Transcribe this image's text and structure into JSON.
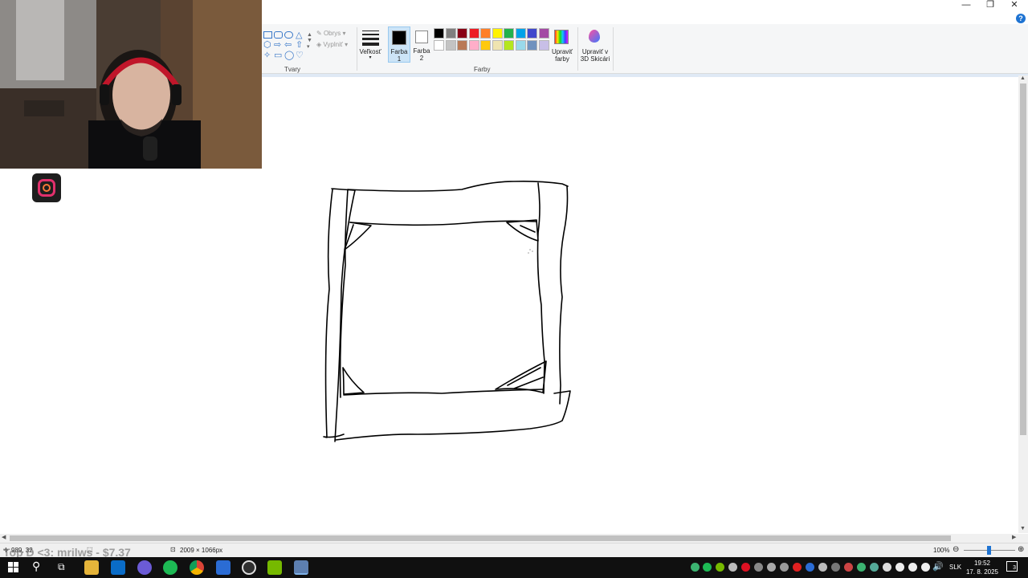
{
  "window": {
    "minimize_icon": "minimize-icon",
    "restore_icon": "restore-icon",
    "close_icon": "close-icon",
    "help_icon": "help-icon"
  },
  "ribbon": {
    "shapes_group_label": "Tvary",
    "outline_label": "Obrys",
    "fill_label": "Vyplniť",
    "size_label": "Veľkosť",
    "color1_label_a": "Farba",
    "color1_label_b": "1",
    "color2_label_a": "Farba",
    "color2_label_b": "2",
    "colors_group_label": "Farby",
    "edit_colors_a": "Upraviť",
    "edit_colors_b": "farby",
    "paint3d_a": "Upraviť v",
    "paint3d_b": "3D Skicári",
    "palette_row1": [
      "#000000",
      "#7f7f7f",
      "#880015",
      "#ed1c24",
      "#ff7f27",
      "#fff200",
      "#22b14c",
      "#00a2e8",
      "#3f48cc",
      "#a349a4"
    ],
    "palette_row2": [
      "#ffffff",
      "#c3c3c3",
      "#b97a57",
      "#ffaec9",
      "#ffc90e",
      "#efe4b0",
      "#b5e61d",
      "#99d9ea",
      "#7092be",
      "#c8bfe7"
    ],
    "color1": "#000000",
    "color2": "#ffffff"
  },
  "status": {
    "cursor_pos": "989, 32",
    "image_size": "2009 × 1066px",
    "zoom": "100%",
    "overlay_text": "Top D <3: mrilws - $7.37"
  },
  "taskbar": {
    "language": "SLK",
    "time": "19:52",
    "date": "17. 8. 2025",
    "notification_count": "3"
  }
}
